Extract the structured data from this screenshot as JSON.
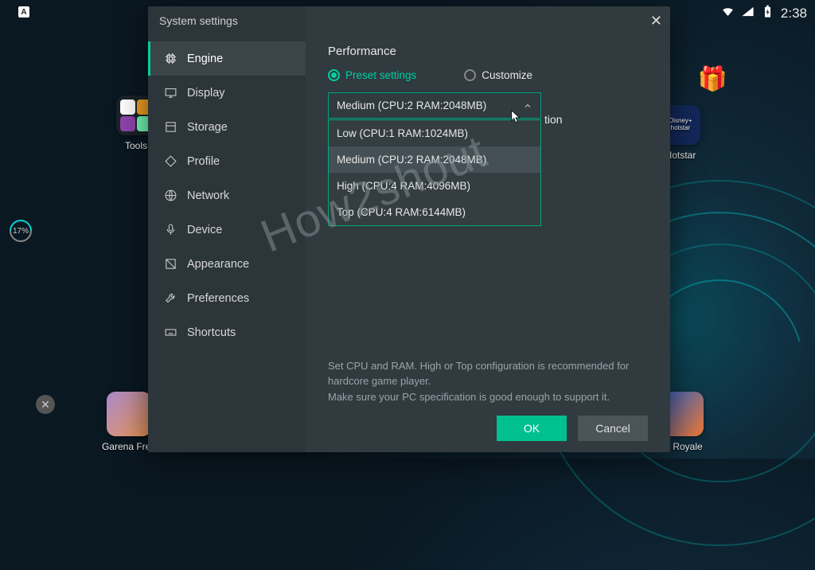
{
  "statusbar": {
    "time": "2:38"
  },
  "desktop": {
    "tools_label": "Tools",
    "hotstar_label": "Hotstar",
    "garena_label": "Garena Free",
    "clash_label": "sh Royale"
  },
  "meter": {
    "value": "17%"
  },
  "modal": {
    "title": "System settings",
    "nav": {
      "engine": "Engine",
      "display": "Display",
      "storage": "Storage",
      "profile": "Profile",
      "network": "Network",
      "device": "Device",
      "appearance": "Appearance",
      "preferences": "Preferences",
      "shortcuts": "Shortcuts"
    },
    "performance": {
      "heading": "Performance",
      "preset_label": "Preset settings",
      "customize_label": "Customize",
      "selected": "Medium (CPU:2 RAM:2048MB)",
      "options": {
        "low": "Low (CPU:1 RAM:1024MB)",
        "medium": "Medium (CPU:2 RAM:2048MB)",
        "high": "High (CPU:4 RAM:4096MB)",
        "top": "Top (CPU:4 RAM:6144MB)"
      },
      "hint_tail": "tion"
    },
    "help_line1": "Set CPU and RAM. High or Top configuration is recommended for hardcore game player.",
    "help_line2": "Make sure your PC specification is good enough to support it.",
    "ok": "OK",
    "cancel": "Cancel"
  },
  "watermark": "How2shout"
}
